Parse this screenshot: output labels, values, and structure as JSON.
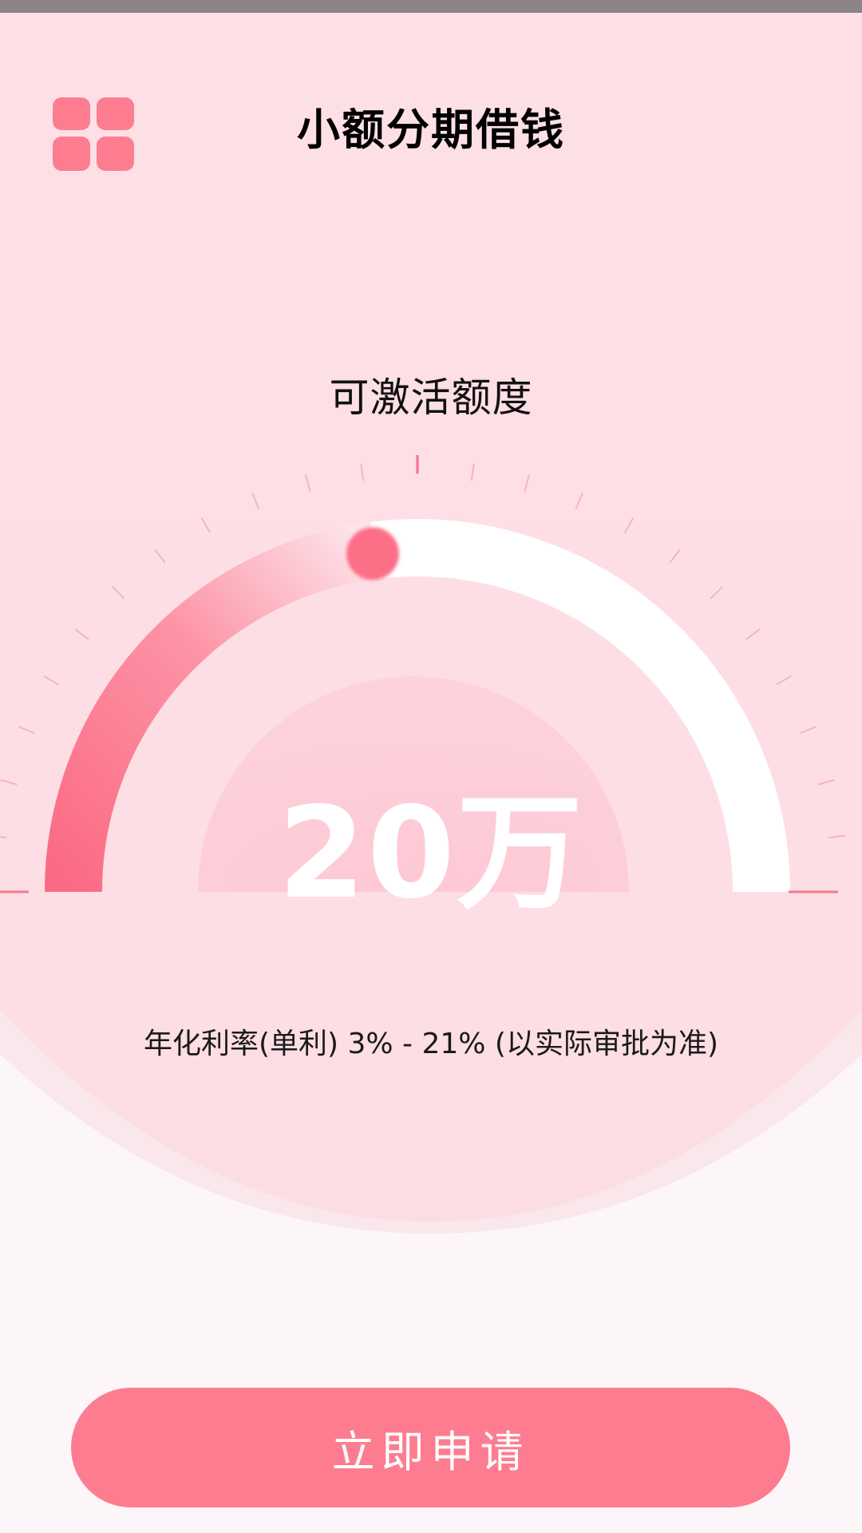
{
  "header": {
    "title": "小额分期借钱",
    "menu_icon": "grid-menu-icon"
  },
  "gauge": {
    "label": "可激活额度",
    "amount": "20万",
    "progress_fraction": 0.46
  },
  "rate_note": "年化利率(单利) 3% - 21% (以实际审批为准)",
  "apply_button": {
    "label": "立即申请"
  },
  "colors": {
    "accent": "#fe7c90",
    "accent_dark": "#f8607c",
    "background_top": "#fde0e6",
    "background_bottom": "#fdf6f8",
    "text": "#000000"
  }
}
